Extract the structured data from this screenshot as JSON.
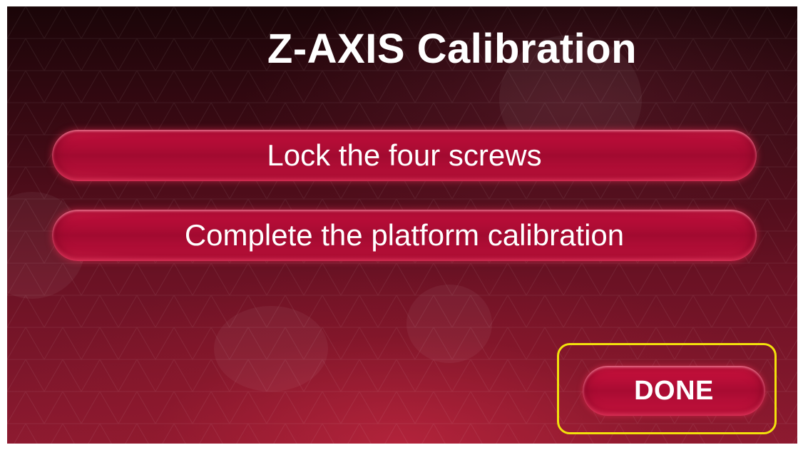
{
  "screen": {
    "title": "Z-AXIS Calibration"
  },
  "steps": [
    {
      "label": "Lock the four screws"
    },
    {
      "label": "Complete the platform calibration"
    }
  ],
  "done_button": {
    "label": "DONE",
    "highlight_color": "#f2e10c"
  },
  "colors": {
    "background_dark": "#1a0508",
    "background_red": "#8d1a30",
    "button_red": "#c8103e",
    "text": "#ffffff"
  }
}
